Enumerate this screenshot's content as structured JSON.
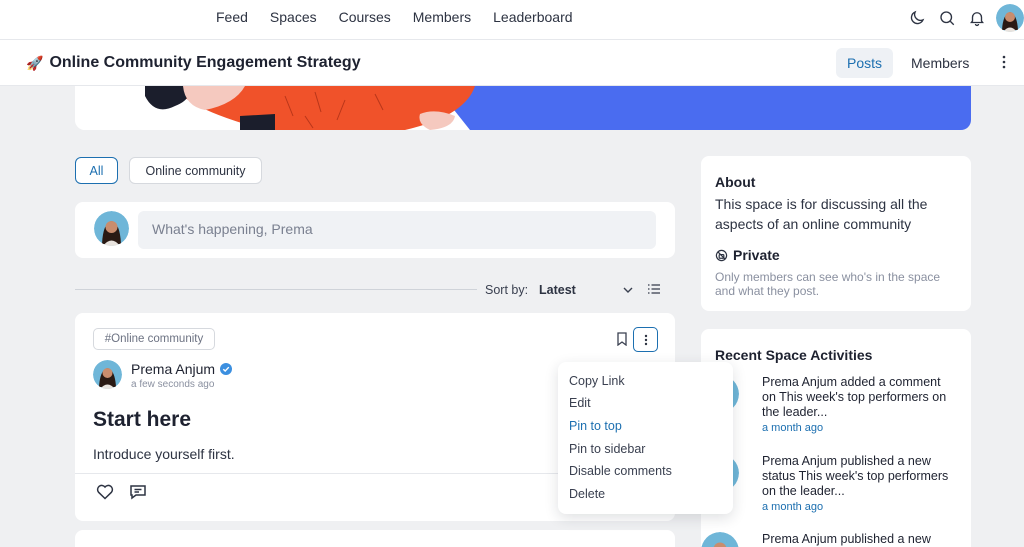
{
  "topnav": {
    "links": [
      "Feed",
      "Spaces",
      "Courses",
      "Members",
      "Leaderboard"
    ],
    "icons": [
      "moon-icon",
      "search-icon",
      "bell-icon"
    ]
  },
  "space": {
    "emoji": "🚀",
    "title": "Online Community Engagement Strategy",
    "tab_posts": "Posts",
    "tab_members": "Members"
  },
  "filters": {
    "all": "All",
    "online_community": "Online community"
  },
  "composer": {
    "placeholder": "What's happening, Prema"
  },
  "sort": {
    "label": "Sort by:",
    "value": "Latest"
  },
  "post": {
    "tag": "#Online community",
    "author": "Prema Anjum",
    "time": "a few seconds ago",
    "title": "Start here",
    "body": "Introduce yourself first."
  },
  "menu": {
    "items": [
      "Copy Link",
      "Edit",
      "Pin to top",
      "Pin to sidebar",
      "Disable comments",
      "Delete"
    ],
    "active_index": 2
  },
  "about": {
    "heading": "About",
    "description": "This space is for discussing all the aspects of an online community",
    "privacy": "Private",
    "privacy_desc": "Only members can see who's in the space and what they post."
  },
  "activity": {
    "heading": "Recent Space Activities",
    "items": [
      {
        "text": "Prema Anjum added a comment on This week's top performers on the leader...",
        "when": "a month ago"
      },
      {
        "text": "Prema Anjum published a new status This week's top performers on the leader...",
        "when": "a month ago"
      },
      {
        "text": "Prema Anjum published a new",
        "when": ""
      }
    ]
  },
  "colors": {
    "accent": "#1c6fb0",
    "verified": "#3b8fe0",
    "banner_orange": "#f0522a",
    "banner_blue": "#4a6cf0"
  }
}
